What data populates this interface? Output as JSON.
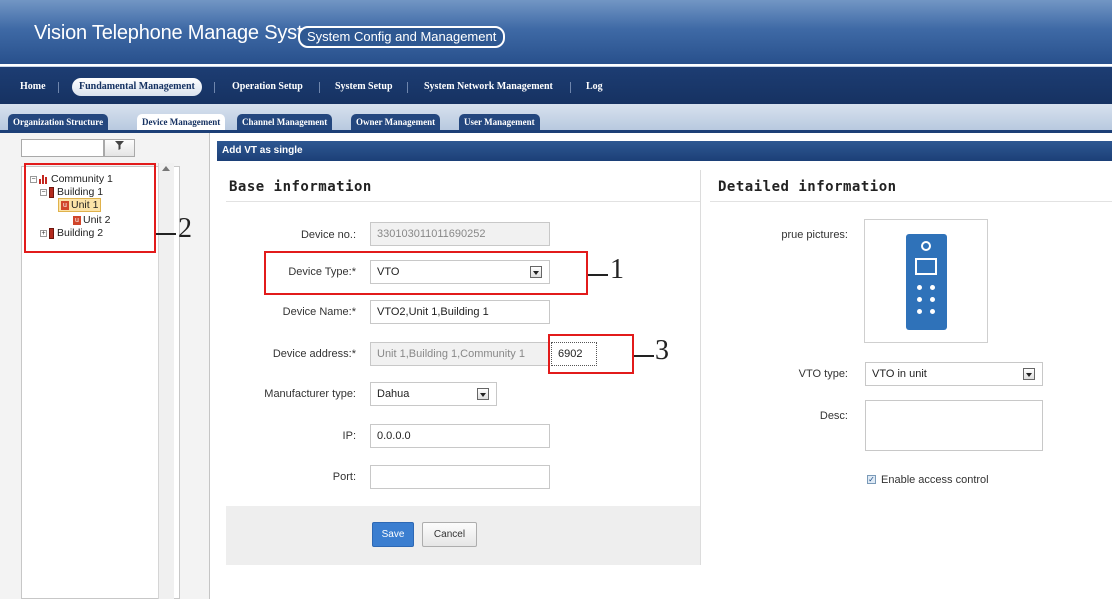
{
  "app": {
    "title": "Vision Telephone Manage System",
    "subtitle": "System Config and Management"
  },
  "nav": {
    "items": [
      "Home",
      "Fundamental Management",
      "Operation Setup",
      "System Setup",
      "System Network Management",
      "Log"
    ],
    "active": "Fundamental Management"
  },
  "subtabs": {
    "items": [
      "Organization Structure",
      "Device Management",
      "Channel Management",
      "Owner Management",
      "User Management"
    ],
    "active": "Device Management"
  },
  "tree": {
    "search_value": "",
    "filter_icon": "filter-funnel-icon",
    "nodes": {
      "community": "Community 1",
      "building1": "Building 1",
      "unit1": "Unit 1",
      "unit2": "Unit 2",
      "building2": "Building 2"
    },
    "selected": "Unit 1"
  },
  "content": {
    "header": "Add VT as single"
  },
  "base": {
    "title": "Base information",
    "device_no_label": "Device no.:",
    "device_no_value": "330103011011690252",
    "device_type_label": "Device Type:*",
    "device_type_value": "VTO",
    "device_name_label": "Device Name:*",
    "device_name_value": "VTO2,Unit 1,Building 1",
    "device_address_label": "Device address:*",
    "device_address_value": "Unit 1,Building 1,Community 1",
    "device_address_suffix": "6902",
    "manufacturer_label": "Manufacturer type:",
    "manufacturer_value": "Dahua",
    "ip_label": "IP:",
    "ip_value": "0.0.0.0",
    "port_label": "Port:",
    "port_value": "",
    "save_label": "Save",
    "cancel_label": "Cancel"
  },
  "detail": {
    "title": "Detailed information",
    "pictures_label": "prue pictures:",
    "vto_type_label": "VTO type:",
    "vto_type_value": "VTO in unit",
    "desc_label": "Desc:",
    "desc_value": "",
    "access_label": "Enable access control",
    "access_checked": true
  },
  "annotations": {
    "one": "1",
    "two": "2",
    "three": "3"
  },
  "colors": {
    "header_blue": "#1c3f77",
    "primary_button": "#3b7ed0",
    "annotation_red": "#e21b1b"
  }
}
